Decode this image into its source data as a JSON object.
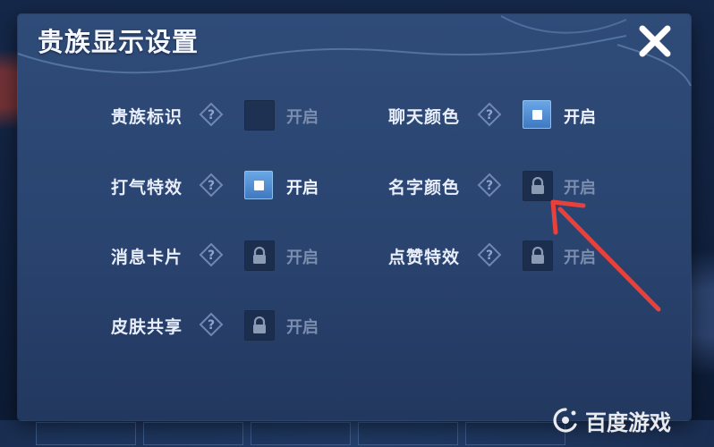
{
  "dialog": {
    "title": "贵族显示设置"
  },
  "settings": {
    "noble_badge": {
      "label": "贵族标识",
      "state": "开启",
      "status": "off"
    },
    "chat_color": {
      "label": "聊天颜色",
      "state": "开启",
      "status": "on"
    },
    "cheer_effect": {
      "label": "打气特效",
      "state": "开启",
      "status": "on"
    },
    "name_color": {
      "label": "名字颜色",
      "state": "开启",
      "status": "locked"
    },
    "message_card": {
      "label": "消息卡片",
      "state": "开启",
      "status": "locked"
    },
    "like_effect": {
      "label": "点赞特效",
      "state": "开启",
      "status": "locked"
    },
    "skin_share": {
      "label": "皮肤共享",
      "state": "开启",
      "status": "locked"
    }
  },
  "annotation": {
    "arrow_color": "#e8413b"
  },
  "watermark": {
    "text": "百度游戏"
  },
  "colors": {
    "panel": "#2f4b78",
    "checkbox_on": "#4f8fd6",
    "text_active": "#f1f5ff",
    "text_dim": "#7c8eae"
  }
}
